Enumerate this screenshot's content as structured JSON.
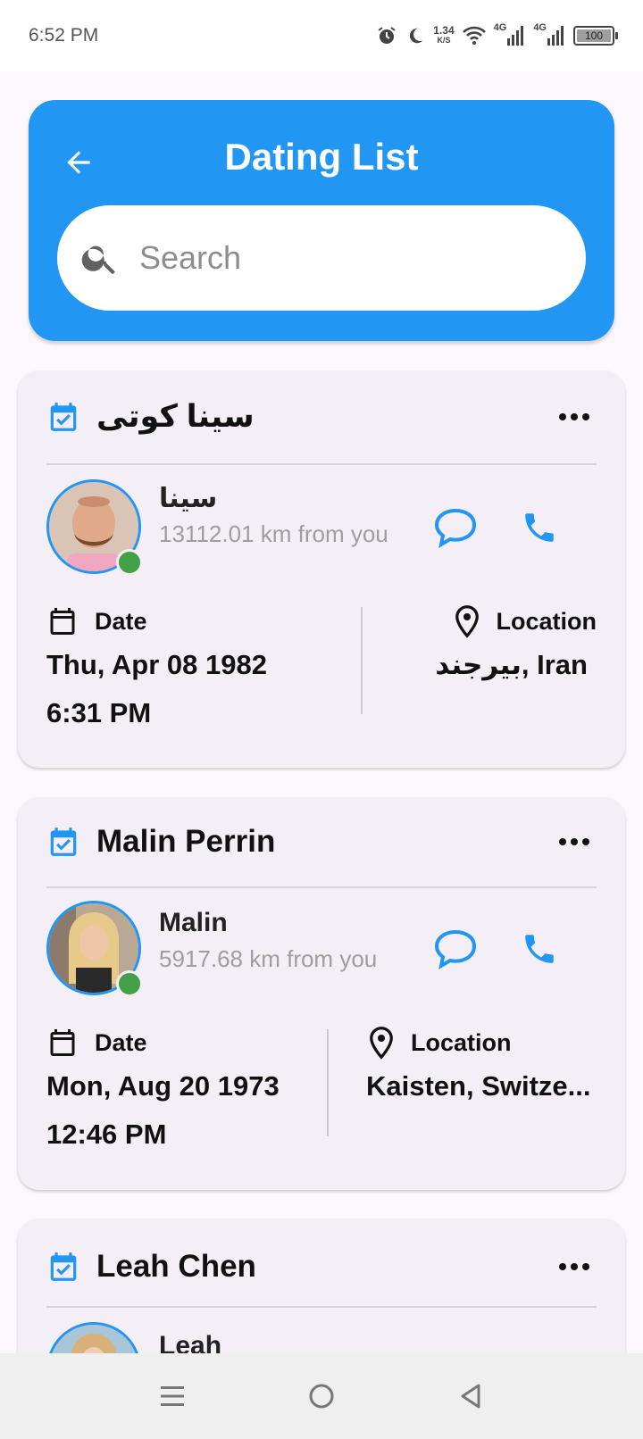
{
  "status_bar": {
    "time": "6:52 PM",
    "net_speed": "1.34",
    "net_speed_unit": "K/S",
    "sim1_label": "4G",
    "sim2_label": "4G",
    "battery_level": "100"
  },
  "header": {
    "title": "Dating List",
    "back_icon": "arrow-left-icon",
    "search_icon": "search-icon",
    "search_placeholder": "Search",
    "background_color": "#2196f3"
  },
  "cards": [
    {
      "full_name": "سینا کوتی",
      "first_name": "سینا",
      "distance": "13112.01 km from you",
      "date_label": "Date",
      "date": "Thu, Apr 08 1982",
      "time": "6:31 PM",
      "location_label": "Location",
      "location": "بیرجند, Iran",
      "online": true
    },
    {
      "full_name": "Malin Perrin",
      "first_name": "Malin",
      "distance": "5917.68 km from you",
      "date_label": "Date",
      "date": "Mon, Aug 20 1973",
      "time": "12:46 PM",
      "location_label": "Location",
      "location": "Kaisten, Switze...",
      "online": true
    },
    {
      "full_name": "Leah Chen",
      "first_name": "Leah",
      "online": true
    }
  ],
  "colors": {
    "accent": "#2196f3",
    "online": "#43a047",
    "card_background": "#f4eef6"
  }
}
